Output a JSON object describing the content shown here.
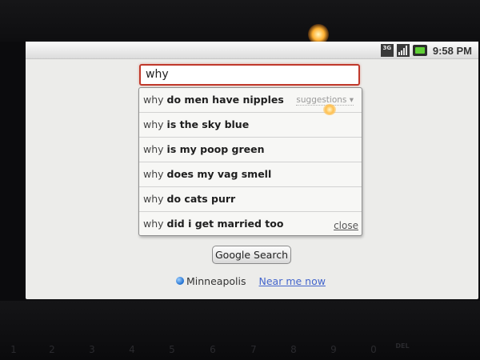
{
  "status_bar": {
    "network_badge": "3G",
    "time": "9:58 PM",
    "icons": [
      "3g-icon",
      "signal-icon",
      "battery-icon"
    ]
  },
  "search": {
    "query": "why",
    "button_label": "Google Search"
  },
  "suggestions": {
    "hint_label": "suggestions ▾",
    "close_label": "close",
    "items": [
      {
        "prefix": "why",
        "completion": "do men have nipples"
      },
      {
        "prefix": "why",
        "completion": "is the sky blue"
      },
      {
        "prefix": "why",
        "completion": "is my poop green"
      },
      {
        "prefix": "why",
        "completion": "does my vag smell"
      },
      {
        "prefix": "why",
        "completion": "do cats purr"
      },
      {
        "prefix": "why",
        "completion": "did i get married too"
      }
    ]
  },
  "location": {
    "city": "Minneapolis",
    "near_me_label": "Near me now"
  },
  "keyboard": {
    "keys": [
      "1",
      "2",
      "3",
      "4",
      "5",
      "6",
      "7",
      "8",
      "9",
      "0",
      "DEL"
    ]
  },
  "colors": {
    "input_border": "#c0392b",
    "link": "#4466cc",
    "location_dot": "#1f6fd0",
    "battery": "#5fcf36"
  }
}
